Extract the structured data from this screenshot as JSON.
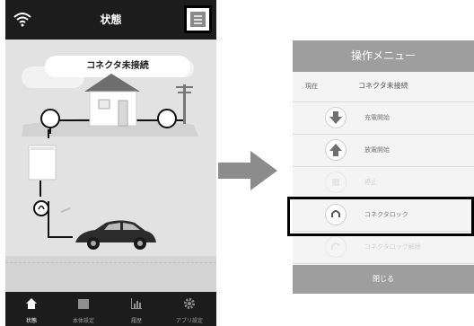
{
  "phone": {
    "title": "状態",
    "status_message": "コネクタ未接続",
    "tabs": [
      {
        "label": "状態",
        "icon": "home-icon",
        "active": true
      },
      {
        "label": "本体設定",
        "icon": "settings-panel-icon",
        "active": false
      },
      {
        "label": "履歴",
        "icon": "bar-chart-icon",
        "active": false
      },
      {
        "label": "アプリ設定",
        "icon": "gear-icon",
        "active": false
      }
    ]
  },
  "menu": {
    "title": "操作メニュー",
    "current_label": "現在",
    "current_value": "コネクタ未接続",
    "items": [
      {
        "label": "充電開始",
        "icon": "arrow-down-icon",
        "enabled": true
      },
      {
        "label": "放電開始",
        "icon": "arrow-up-icon",
        "enabled": true
      },
      {
        "label": "停止",
        "icon": "stop-icon",
        "enabled": false
      },
      {
        "label": "コネクタロック",
        "icon": "lock-icon",
        "enabled": true
      },
      {
        "label": "コネクタロック解除",
        "icon": "unlock-icon",
        "enabled": false
      }
    ],
    "close_label": "閉じる"
  },
  "colors": {
    "dark_bar": "#1c1c1c",
    "menu_header": "#9e9e9e",
    "highlight_border": "#000000",
    "arrow": "#8c8c8c"
  }
}
